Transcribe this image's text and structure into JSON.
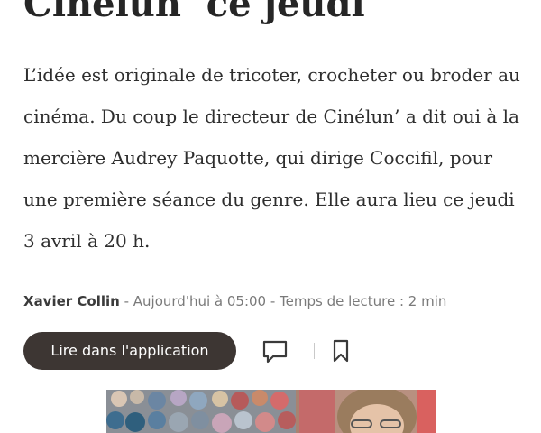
{
  "article": {
    "title": "Cinélun’ ce jeudi",
    "lead": "L’idée est originale de tricoter, crocheter ou broder au cinéma. Du coup le directeur de Cinélun’ a dit oui à la mercière Audrey Paquotte, qui dirige Coccifil, pour une première séance du genre. Elle aura lieu ce jeudi 3 avril à 20 h.",
    "author": "Xavier Collin",
    "meta_rest": " - Aujourd'hui à 05:00 - Temps de lecture : 2 min"
  },
  "actions": {
    "app_button_label": "Lire dans l'application",
    "comment_icon": "comment-icon",
    "bookmark_icon": "bookmark-icon"
  },
  "colors": {
    "button_bg": "#3d3633",
    "button_text": "#ffffff",
    "meta_text": "#7a7a7a"
  }
}
